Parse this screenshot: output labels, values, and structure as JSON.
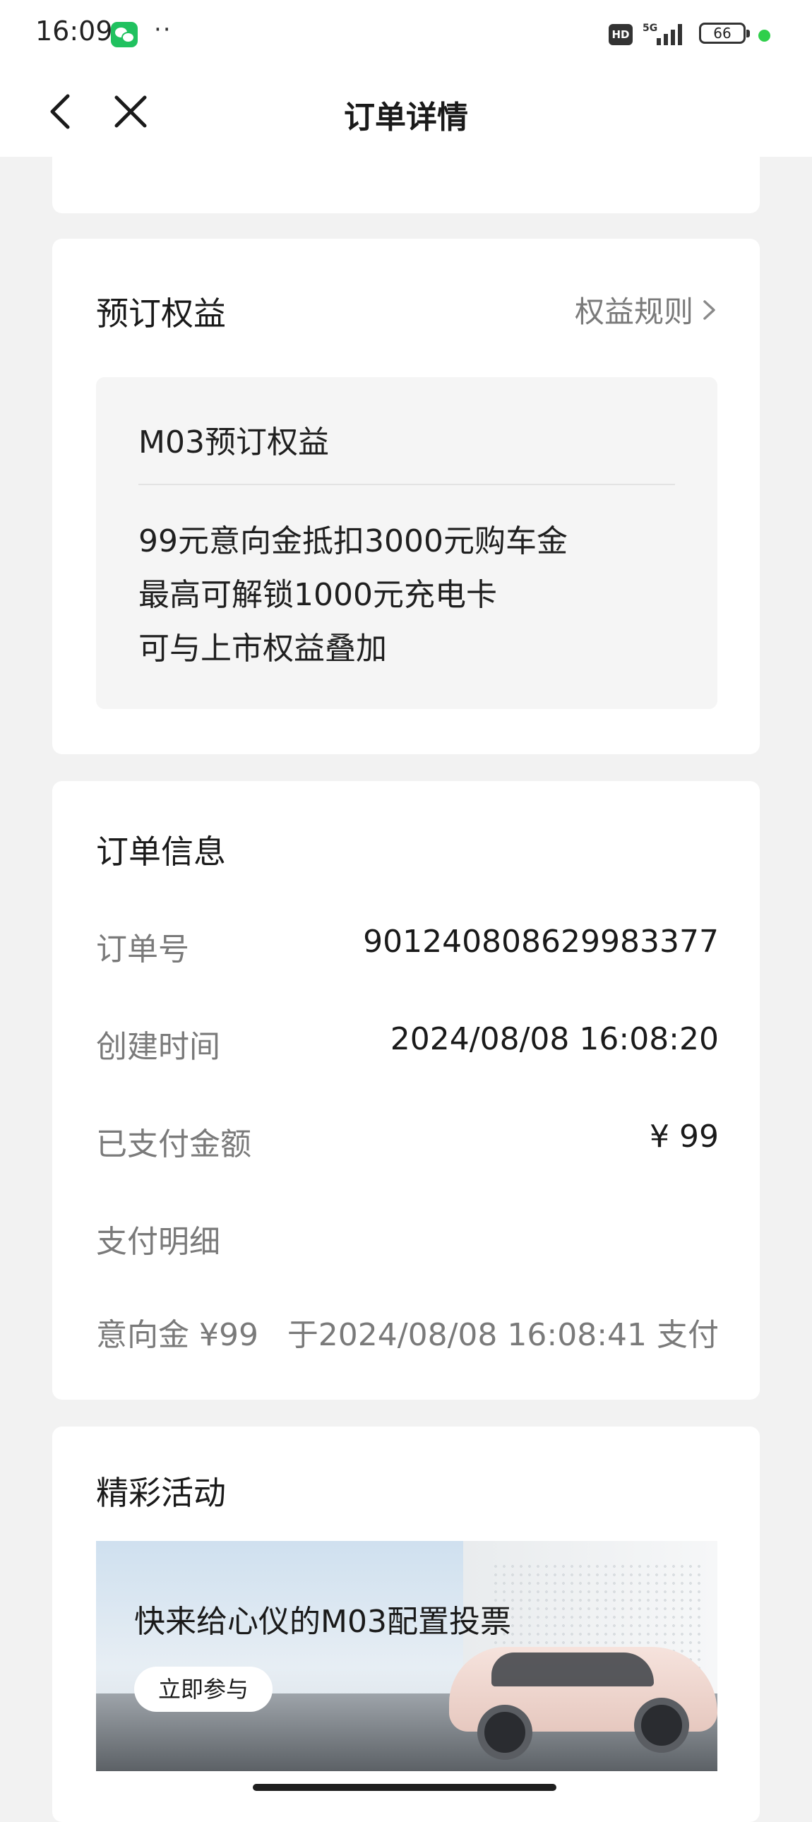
{
  "status": {
    "time": "16:09",
    "dots": "··",
    "hd": "HD",
    "network": "5G",
    "battery": "66"
  },
  "nav": {
    "title": "订单详情"
  },
  "cut_card": {
    "text": ""
  },
  "benefit": {
    "title": "预订权益",
    "rules_label": "权益规则",
    "box_title": "M03预订权益",
    "lines": [
      "99元意向金抵扣3000元购车金",
      "最高可解锁1000元充电卡",
      "可与上市权益叠加"
    ]
  },
  "order": {
    "title": "订单信息",
    "rows": [
      {
        "label": "订单号",
        "value": "901240808629983377"
      },
      {
        "label": "创建时间",
        "value": "2024/08/08 16:08:20"
      },
      {
        "label": "已支付金额",
        "value": "¥ 99"
      },
      {
        "label": "支付明细",
        "value": ""
      }
    ],
    "payment_detail": {
      "label": "意向金 ¥99",
      "value": "于2024/08/08 16:08:41 支付"
    }
  },
  "activity": {
    "title": "精彩活动",
    "banner_text": "快来给心仪的M03配置投票",
    "banner_button": "立即参与"
  }
}
